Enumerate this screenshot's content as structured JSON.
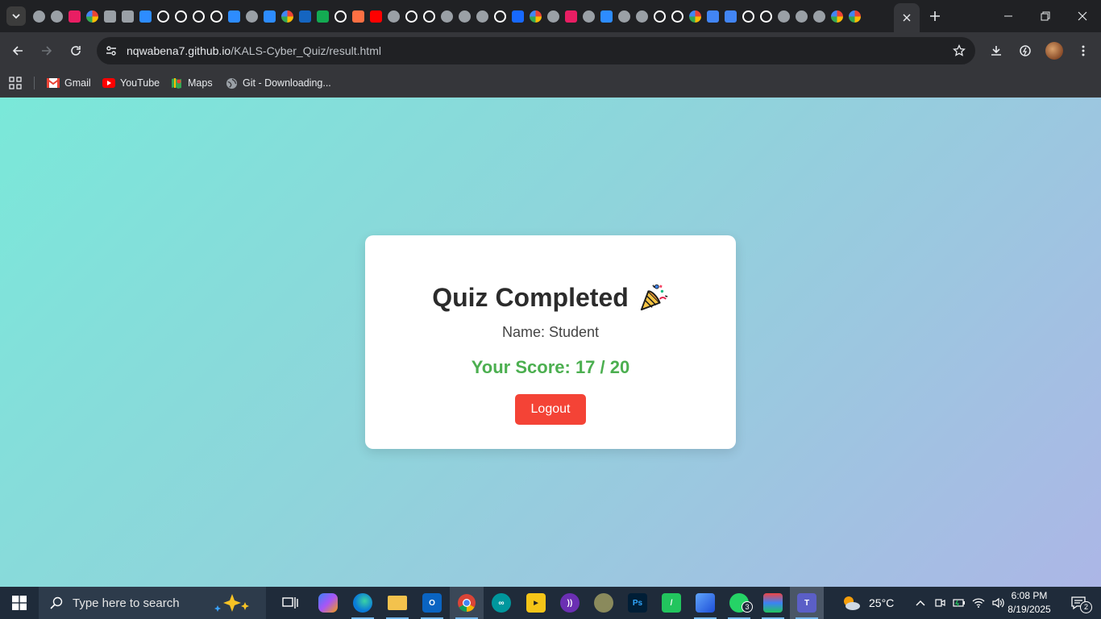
{
  "browser": {
    "address": {
      "host": "nqwabena7.github.io",
      "path": "/KALS-Cyber_Quiz/result.html"
    },
    "tabs": [
      {
        "icon": "chrome-icon",
        "color": "#9aa0a6"
      },
      {
        "icon": "globe-icon",
        "color": "#9aa0a6"
      },
      {
        "icon": "app-icon",
        "color": "#e91e63"
      },
      {
        "icon": "google-icon",
        "color": "#ffffff"
      },
      {
        "icon": "whatsapp-icon",
        "color": "#9aa0a6"
      },
      {
        "icon": "alert-icon",
        "color": "#9aa0a6"
      },
      {
        "icon": "zoom-icon",
        "color": "#2d8cff"
      },
      {
        "icon": "github-icon",
        "color": "#ffffff"
      },
      {
        "icon": "github-icon",
        "color": "#ffffff"
      },
      {
        "icon": "github-icon",
        "color": "#ffffff"
      },
      {
        "icon": "github-icon",
        "color": "#ffffff"
      },
      {
        "icon": "zoom-icon",
        "color": "#2d8cff"
      },
      {
        "icon": "globe-icon",
        "color": "#9aa0a6"
      },
      {
        "icon": "zoom-icon",
        "color": "#2d8cff"
      },
      {
        "icon": "google-icon",
        "color": "#ffffff"
      },
      {
        "icon": "app-icon",
        "color": "#1565c0"
      },
      {
        "icon": "mongodb-icon",
        "color": "#13aa52"
      },
      {
        "icon": "x-icon",
        "color": "#ffffff"
      },
      {
        "icon": "app-icon",
        "color": "#ff7043"
      },
      {
        "icon": "youtube-icon",
        "color": "#ff0000"
      },
      {
        "icon": "globe-icon",
        "color": "#9aa0a6"
      },
      {
        "icon": "openai-icon",
        "color": "#ffffff"
      },
      {
        "icon": "openai-icon",
        "color": "#ffffff"
      },
      {
        "icon": "globe-icon",
        "color": "#9aa0a6"
      },
      {
        "icon": "globe-icon",
        "color": "#9aa0a6"
      },
      {
        "icon": "globe-icon",
        "color": "#9aa0a6"
      },
      {
        "icon": "download-icon",
        "color": "#ffffff"
      },
      {
        "icon": "behance-icon",
        "color": "#1769ff"
      },
      {
        "icon": "google-icon",
        "color": "#ffffff"
      },
      {
        "icon": "globe-icon",
        "color": "#9aa0a6"
      },
      {
        "icon": "app-icon",
        "color": "#e91e63"
      },
      {
        "icon": "globe-icon",
        "color": "#9aa0a6"
      },
      {
        "icon": "zoom-icon",
        "color": "#2d8cff"
      },
      {
        "icon": "globe-icon",
        "color": "#9aa0a6"
      },
      {
        "icon": "globe-icon",
        "color": "#9aa0a6"
      },
      {
        "icon": "github-icon",
        "color": "#ffffff"
      },
      {
        "icon": "github-icon",
        "color": "#ffffff"
      },
      {
        "icon": "google-icon",
        "color": "#ffffff"
      },
      {
        "icon": "forms-icon",
        "color": "#4285f4"
      },
      {
        "icon": "forms-icon",
        "color": "#4285f4"
      },
      {
        "icon": "dollar-icon",
        "color": "#ffffff"
      },
      {
        "icon": "github-icon",
        "color": "#ffffff"
      },
      {
        "icon": "globe-icon",
        "color": "#9aa0a6"
      },
      {
        "icon": "globe-icon",
        "color": "#9aa0a6"
      },
      {
        "icon": "globe-icon",
        "color": "#9aa0a6"
      },
      {
        "icon": "google-icon",
        "color": "#ffffff"
      },
      {
        "icon": "google-icon",
        "color": "#ffffff"
      }
    ],
    "bookmarks": [
      {
        "label": "Gmail",
        "icon": "gmail-icon"
      },
      {
        "label": "YouTube",
        "icon": "youtube-icon"
      },
      {
        "label": "Maps",
        "icon": "maps-icon"
      },
      {
        "label": "Git - Downloading...",
        "icon": "globe-icon"
      }
    ]
  },
  "page": {
    "title": "Quiz Completed",
    "title_emoji": "party-popper-icon",
    "name_line": "Name: Student",
    "score_line": "Your Score: 17 / 20",
    "logout_label": "Logout",
    "colors": {
      "score": "#4caf50",
      "logout": "#f44336",
      "gradient_start": "#7ae8d9",
      "gradient_end": "#acb6e6"
    }
  },
  "taskbar": {
    "search_placeholder": "Type here to search",
    "apps": [
      {
        "name": "task-view-icon"
      },
      {
        "name": "copilot-icon"
      },
      {
        "name": "edge-icon"
      },
      {
        "name": "file-explorer-icon"
      },
      {
        "name": "outlook-icon"
      },
      {
        "name": "chrome-icon"
      },
      {
        "name": "arduino-icon"
      },
      {
        "name": "player-icon"
      },
      {
        "name": "app-icon"
      },
      {
        "name": "app-icon"
      },
      {
        "name": "photoshop-icon"
      },
      {
        "name": "app-icon"
      },
      {
        "name": "photos-icon"
      },
      {
        "name": "whatsapp-icon",
        "badge": "3"
      },
      {
        "name": "app-icon"
      },
      {
        "name": "teams-icon"
      }
    ],
    "weather": {
      "temp": "25°C"
    },
    "clock": {
      "time": "6:08 PM",
      "date": "8/19/2025"
    },
    "notifications": "2"
  }
}
